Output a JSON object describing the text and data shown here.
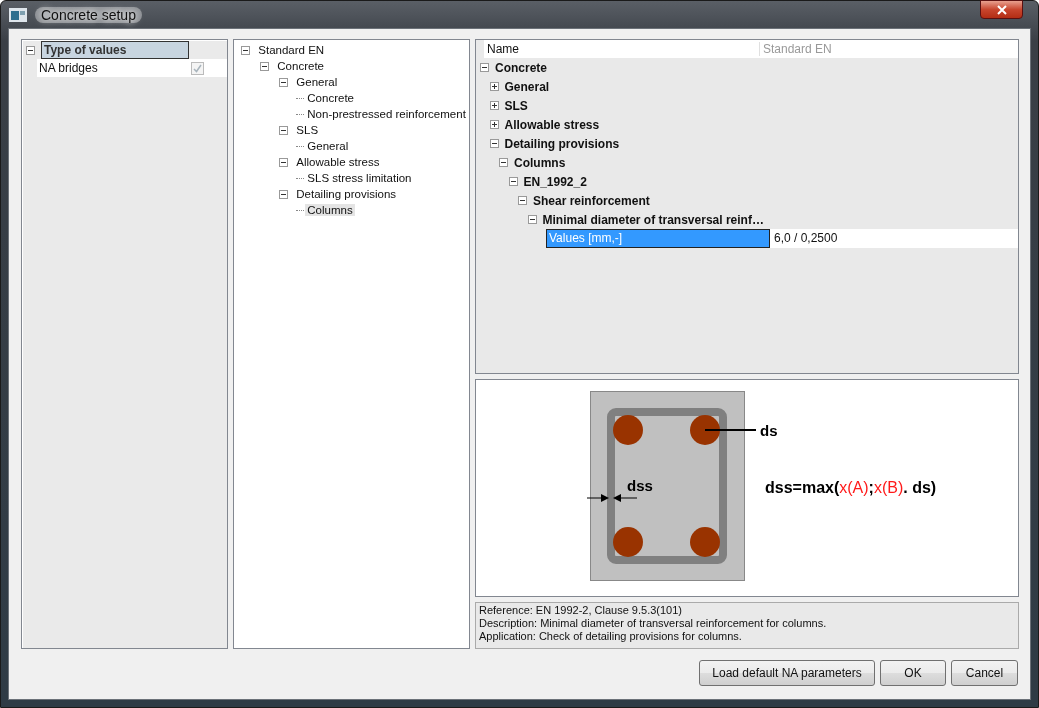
{
  "window": {
    "title": "Concrete setup"
  },
  "settings": {
    "group": {
      "label": "Type of values",
      "expanded": true
    },
    "rows": [
      {
        "label": "NA bridges",
        "checked": true
      }
    ]
  },
  "tree": [
    {
      "label": "Standard EN",
      "expanded": true,
      "selected": false,
      "children": [
        {
          "label": "Concrete",
          "expanded": true,
          "selected": false,
          "children": [
            {
              "label": "General",
              "expanded": true,
              "selected": false,
              "children": [
                {
                  "label": "Concrete",
                  "selected": false
                },
                {
                  "label": "Non-prestressed reinforcement",
                  "selected": false
                }
              ]
            },
            {
              "label": "SLS",
              "expanded": true,
              "selected": false,
              "children": [
                {
                  "label": "General",
                  "selected": false
                }
              ]
            },
            {
              "label": "Allowable stress",
              "expanded": true,
              "selected": false,
              "children": [
                {
                  "label": "SLS stress limitation",
                  "selected": false
                }
              ]
            },
            {
              "label": "Detailing provisions",
              "expanded": true,
              "selected": false,
              "children": [
                {
                  "label": "Columns",
                  "selected": true
                }
              ]
            }
          ]
        }
      ]
    }
  ],
  "properties": {
    "columns": [
      "Name",
      "Standard EN"
    ],
    "rows": [
      {
        "label": "Concrete",
        "expanded": true,
        "children": [
          {
            "label": "General",
            "expanded": false
          },
          {
            "label": "SLS",
            "expanded": false
          },
          {
            "label": "Allowable stress",
            "expanded": false
          },
          {
            "label": "Detailing provisions",
            "expanded": true,
            "children": [
              {
                "label": "Columns",
                "expanded": true,
                "children": [
                  {
                    "label": "EN_1992_2",
                    "expanded": true,
                    "children": [
                      {
                        "label": "Shear reinforcement",
                        "expanded": true,
                        "children": [
                          {
                            "label": "Minimal diameter of transversal reinf…",
                            "expanded": true,
                            "children": [
                              {
                                "label": "Values [mm,-]",
                                "value": "6,0 / 0,2500",
                                "selected": true
                              }
                            ]
                          }
                        ]
                      }
                    ]
                  }
                ]
              }
            ]
          }
        ]
      }
    ]
  },
  "diagram": {
    "bar_label": "ds",
    "stirrup_label": "dss",
    "formula": [
      {
        "kind": "plain",
        "text": "dss=max("
      },
      {
        "kind": "variable",
        "text": "x(A)"
      },
      {
        "kind": "plain",
        "text": ";"
      },
      {
        "kind": "variable",
        "text": "x(B)"
      },
      {
        "kind": "plain",
        "text": ". ds)"
      }
    ]
  },
  "description": [
    "Reference: EN 1992-2, Clause 9.5.3(101)",
    "Description: Minimal diameter of transversal reinforcement for columns.",
    "Application: Check of detailing provisions for columns."
  ],
  "buttons": [
    "Load default NA parameters",
    "OK",
    "Cancel"
  ]
}
